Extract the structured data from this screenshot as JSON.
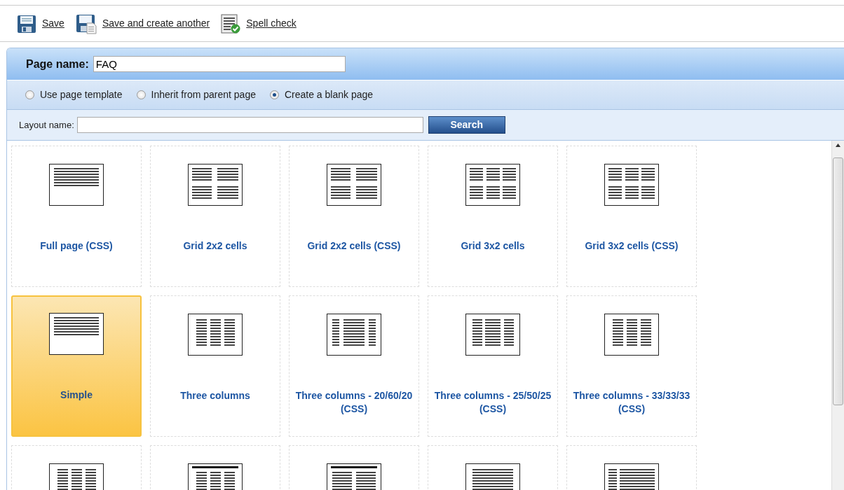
{
  "toolbar": [
    {
      "kind": "save",
      "label": "Save"
    },
    {
      "kind": "save-new",
      "label": "Save and create another"
    },
    {
      "kind": "spellcheck",
      "label": "Spell check"
    }
  ],
  "page_name": {
    "label": "Page name:",
    "value": "FAQ"
  },
  "options": [
    {
      "label": "Use page template",
      "selected": false
    },
    {
      "label": "Inherit from parent page",
      "selected": false
    },
    {
      "label": "Create a blank page",
      "selected": true
    }
  ],
  "layout_search": {
    "label": "Layout name:",
    "button": "Search"
  },
  "layouts": [
    {
      "kind": "full",
      "label": "Full page (CSS)",
      "selected": false
    },
    {
      "kind": "grid2x2",
      "label": "Grid 2x2 cells",
      "selected": false
    },
    {
      "kind": "grid2x2",
      "label": "Grid 2x2 cells (CSS)",
      "selected": false
    },
    {
      "kind": "grid3x2",
      "label": "Grid 3x2 cells",
      "selected": false
    },
    {
      "kind": "grid3x2",
      "label": "Grid 3x2 cells (CSS)",
      "selected": false
    },
    {
      "kind": "full",
      "label": "Simple",
      "selected": true
    },
    {
      "kind": "cols3",
      "label": "Three columns",
      "selected": false
    },
    {
      "kind": "cols3-wide",
      "label": "Three columns - 20/60/20 (CSS)",
      "selected": false
    },
    {
      "kind": "cols3-mid",
      "label": "Three columns - 25/50/25 (CSS)",
      "selected": false
    },
    {
      "kind": "cols3",
      "label": "Three columns - 33/33/33 (CSS)",
      "selected": false
    },
    {
      "kind": "cols3",
      "selected": false
    },
    {
      "kind": "header-cols3",
      "selected": false
    },
    {
      "kind": "header-cols2",
      "selected": false
    },
    {
      "kind": "cols2-wide",
      "selected": false
    },
    {
      "kind": "sidebar",
      "selected": false
    }
  ]
}
